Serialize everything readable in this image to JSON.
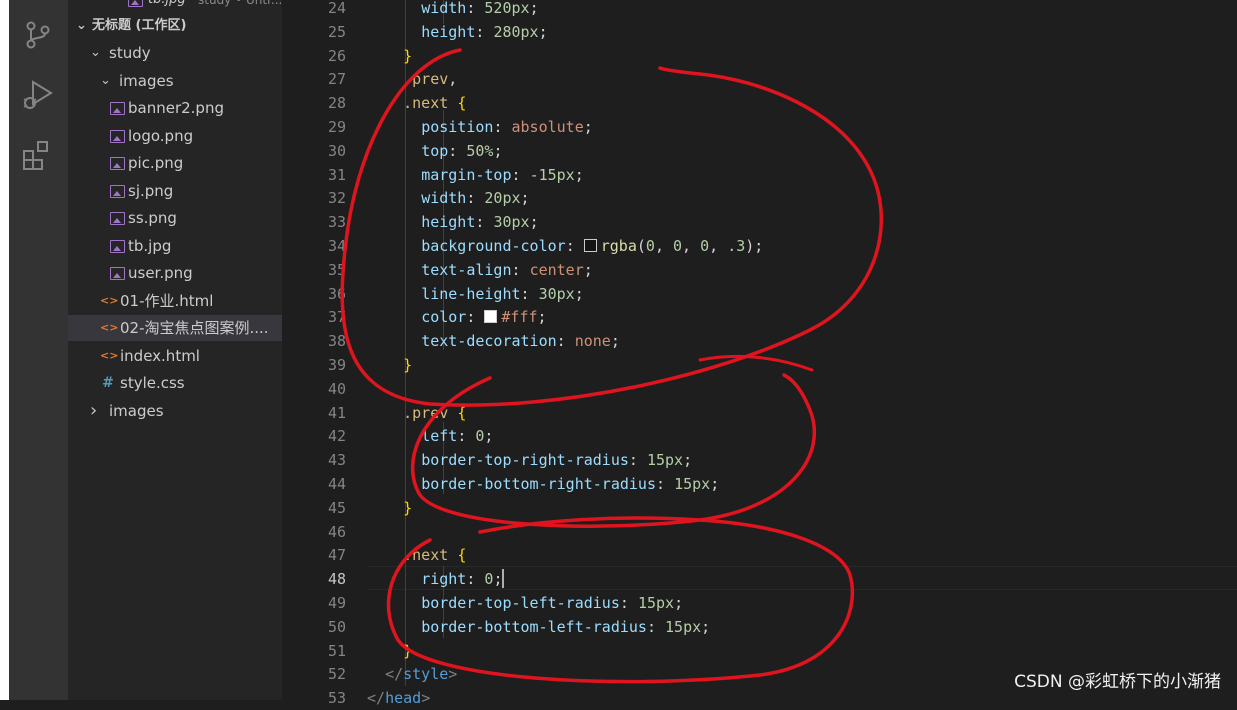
{
  "explorer": {
    "top_partial_label": "tb.jpg",
    "top_partial_desc": "study • Untr...",
    "workspace_title": "无标题 (工作区)",
    "tree": [
      {
        "label": "study",
        "type": "folder-open",
        "depth": 1
      },
      {
        "label": "images",
        "type": "folder-open",
        "depth": 2
      },
      {
        "label": "banner2.png",
        "type": "image",
        "depth": 3
      },
      {
        "label": "logo.png",
        "type": "image",
        "depth": 3
      },
      {
        "label": "pic.png",
        "type": "image",
        "depth": 3
      },
      {
        "label": "sj.png",
        "type": "image",
        "depth": 3
      },
      {
        "label": "ss.png",
        "type": "image",
        "depth": 3
      },
      {
        "label": "tb.jpg",
        "type": "image",
        "depth": 3
      },
      {
        "label": "user.png",
        "type": "image",
        "depth": 3
      },
      {
        "label": "01-作业.html",
        "type": "html",
        "depth": 2
      },
      {
        "label": "02-淘宝焦点图案例....",
        "type": "html",
        "depth": 2,
        "selected": true
      },
      {
        "label": "index.html",
        "type": "html",
        "depth": 2
      },
      {
        "label": "style.css",
        "type": "css",
        "depth": 2
      },
      {
        "label": "images",
        "type": "folder-closed",
        "depth": 1
      }
    ]
  },
  "activity_bar": {
    "icons": [
      "source-control-icon",
      "run-debug-icon",
      "extensions-icon"
    ]
  },
  "editor": {
    "active_line": 48,
    "lines": [
      {
        "n": 24,
        "tokens": [
          [
            "      ",
            "punct"
          ],
          [
            "width",
            "prop"
          ],
          [
            ": ",
            "punct"
          ],
          [
            "520px",
            "num"
          ],
          [
            ";",
            "punct"
          ]
        ]
      },
      {
        "n": 25,
        "tokens": [
          [
            "      ",
            "punct"
          ],
          [
            "height",
            "prop"
          ],
          [
            ": ",
            "punct"
          ],
          [
            "280px",
            "num"
          ],
          [
            ";",
            "punct"
          ]
        ]
      },
      {
        "n": 26,
        "tokens": [
          [
            "    ",
            "punct"
          ],
          [
            "}",
            "brace"
          ]
        ]
      },
      {
        "n": 27,
        "tokens": [
          [
            "    ",
            "punct"
          ],
          [
            ".prev",
            "sel"
          ],
          [
            ",",
            "punct"
          ]
        ]
      },
      {
        "n": 28,
        "tokens": [
          [
            "    ",
            "punct"
          ],
          [
            ".next",
            "sel"
          ],
          [
            " ",
            "punct"
          ],
          [
            "{",
            "brace"
          ]
        ]
      },
      {
        "n": 29,
        "tokens": [
          [
            "      ",
            "punct"
          ],
          [
            "position",
            "prop"
          ],
          [
            ": ",
            "punct"
          ],
          [
            "absolute",
            "val"
          ],
          [
            ";",
            "punct"
          ]
        ]
      },
      {
        "n": 30,
        "tokens": [
          [
            "      ",
            "punct"
          ],
          [
            "top",
            "prop"
          ],
          [
            ": ",
            "punct"
          ],
          [
            "50%",
            "num"
          ],
          [
            ";",
            "punct"
          ]
        ]
      },
      {
        "n": 31,
        "tokens": [
          [
            "      ",
            "punct"
          ],
          [
            "margin-top",
            "prop"
          ],
          [
            ": ",
            "punct"
          ],
          [
            "-15px",
            "num"
          ],
          [
            ";",
            "punct"
          ]
        ]
      },
      {
        "n": 32,
        "tokens": [
          [
            "      ",
            "punct"
          ],
          [
            "width",
            "prop"
          ],
          [
            ": ",
            "punct"
          ],
          [
            "20px",
            "num"
          ],
          [
            ";",
            "punct"
          ]
        ]
      },
      {
        "n": 33,
        "tokens": [
          [
            "      ",
            "punct"
          ],
          [
            "height",
            "prop"
          ],
          [
            ": ",
            "punct"
          ],
          [
            "30px",
            "num"
          ],
          [
            ";",
            "punct"
          ]
        ]
      },
      {
        "n": 34,
        "tokens": [
          [
            "      ",
            "punct"
          ],
          [
            "background-color",
            "prop"
          ],
          [
            ": ",
            "punct"
          ],
          [
            "",
            "swatch-dark"
          ],
          [
            "rgba",
            "fn"
          ],
          [
            "(",
            "punct"
          ],
          [
            "0",
            "num"
          ],
          [
            ", ",
            "punct"
          ],
          [
            "0",
            "num"
          ],
          [
            ", ",
            "punct"
          ],
          [
            "0",
            "num"
          ],
          [
            ", ",
            "punct"
          ],
          [
            ".3",
            "num"
          ],
          [
            ");",
            "punct"
          ]
        ]
      },
      {
        "n": 35,
        "tokens": [
          [
            "      ",
            "punct"
          ],
          [
            "text-align",
            "prop"
          ],
          [
            ": ",
            "punct"
          ],
          [
            "center",
            "val"
          ],
          [
            ";",
            "punct"
          ]
        ]
      },
      {
        "n": 36,
        "tokens": [
          [
            "      ",
            "punct"
          ],
          [
            "line-height",
            "prop"
          ],
          [
            ": ",
            "punct"
          ],
          [
            "30px",
            "num"
          ],
          [
            ";",
            "punct"
          ]
        ]
      },
      {
        "n": 37,
        "tokens": [
          [
            "      ",
            "punct"
          ],
          [
            "color",
            "prop"
          ],
          [
            ": ",
            "punct"
          ],
          [
            "",
            "swatch-white"
          ],
          [
            "#fff",
            "val"
          ],
          [
            ";",
            "punct"
          ]
        ]
      },
      {
        "n": 38,
        "tokens": [
          [
            "      ",
            "punct"
          ],
          [
            "text-decoration",
            "prop"
          ],
          [
            ": ",
            "punct"
          ],
          [
            "none",
            "val"
          ],
          [
            ";",
            "punct"
          ]
        ]
      },
      {
        "n": 39,
        "tokens": [
          [
            "    ",
            "punct"
          ],
          [
            "}",
            "brace"
          ]
        ]
      },
      {
        "n": 40,
        "tokens": []
      },
      {
        "n": 41,
        "tokens": [
          [
            "    ",
            "punct"
          ],
          [
            ".prev",
            "sel"
          ],
          [
            " ",
            "punct"
          ],
          [
            "{",
            "brace"
          ]
        ]
      },
      {
        "n": 42,
        "tokens": [
          [
            "      ",
            "punct"
          ],
          [
            "left",
            "prop"
          ],
          [
            ": ",
            "punct"
          ],
          [
            "0",
            "num"
          ],
          [
            ";",
            "punct"
          ]
        ]
      },
      {
        "n": 43,
        "tokens": [
          [
            "      ",
            "punct"
          ],
          [
            "border-top-right-radius",
            "prop"
          ],
          [
            ": ",
            "punct"
          ],
          [
            "15px",
            "num"
          ],
          [
            ";",
            "punct"
          ]
        ]
      },
      {
        "n": 44,
        "tokens": [
          [
            "      ",
            "punct"
          ],
          [
            "border-bottom-right-radius",
            "prop"
          ],
          [
            ": ",
            "punct"
          ],
          [
            "15px",
            "num"
          ],
          [
            ";",
            "punct"
          ]
        ]
      },
      {
        "n": 45,
        "tokens": [
          [
            "    ",
            "punct"
          ],
          [
            "}",
            "brace"
          ]
        ]
      },
      {
        "n": 46,
        "tokens": []
      },
      {
        "n": 47,
        "tokens": [
          [
            "    ",
            "punct"
          ],
          [
            ".next",
            "sel"
          ],
          [
            " ",
            "punct"
          ],
          [
            "{",
            "brace"
          ]
        ]
      },
      {
        "n": 48,
        "tokens": [
          [
            "      ",
            "punct"
          ],
          [
            "right",
            "prop"
          ],
          [
            ": ",
            "punct"
          ],
          [
            "0",
            "num"
          ],
          [
            ";",
            "punct"
          ]
        ]
      },
      {
        "n": 49,
        "tokens": [
          [
            "      ",
            "punct"
          ],
          [
            "border-top-left-radius",
            "prop"
          ],
          [
            ": ",
            "punct"
          ],
          [
            "15px",
            "num"
          ],
          [
            ";",
            "punct"
          ]
        ]
      },
      {
        "n": 50,
        "tokens": [
          [
            "      ",
            "punct"
          ],
          [
            "border-bottom-left-radius",
            "prop"
          ],
          [
            ": ",
            "punct"
          ],
          [
            "15px",
            "num"
          ],
          [
            ";",
            "punct"
          ]
        ]
      },
      {
        "n": 51,
        "tokens": [
          [
            "    ",
            "punct"
          ],
          [
            "}",
            "brace"
          ]
        ]
      },
      {
        "n": 52,
        "tokens": [
          [
            "  ",
            "punct"
          ],
          [
            "</",
            "tag"
          ],
          [
            "style",
            "tagname"
          ],
          [
            ">",
            "tag"
          ]
        ]
      },
      {
        "n": 53,
        "tokens": [
          [
            "</",
            "tag"
          ],
          [
            "head",
            "tagname"
          ],
          [
            ">",
            "tag"
          ]
        ]
      }
    ]
  },
  "watermark": "CSDN @彩虹桥下的小渐猪",
  "colors": {
    "annotation_red": "#e0141e",
    "editor_bg": "#1e1e1e",
    "sidebar_bg": "#252526",
    "activity_bg": "#333333",
    "selector": "#d7ba7d",
    "property": "#9cdcfe",
    "value": "#ce9178",
    "number": "#b5cea8",
    "brace": "#ffd700"
  }
}
